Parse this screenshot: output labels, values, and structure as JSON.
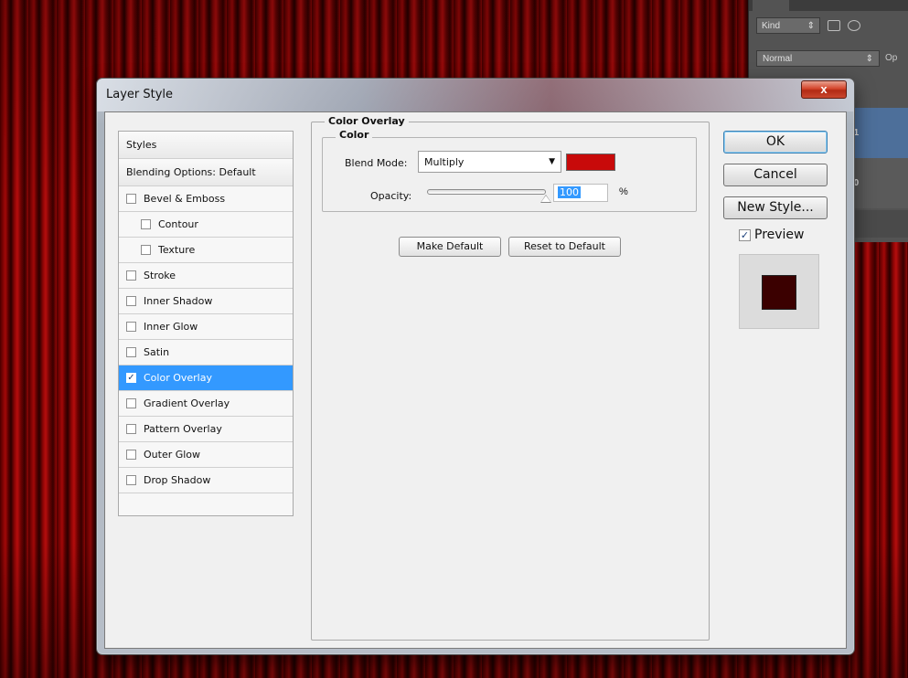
{
  "layers_panel": {
    "filter_label": "Kind",
    "blend_mode": "Normal",
    "opacity_label": "Op",
    "layers": [
      "r 1",
      "r 0"
    ]
  },
  "dialog": {
    "title": "Layer Style",
    "close_label": "x"
  },
  "styles_list": {
    "header": "Styles",
    "blending_options": "Blending Options: Default",
    "items": [
      {
        "label": "Bevel & Emboss",
        "checked": false,
        "indent": false,
        "selected": false
      },
      {
        "label": "Contour",
        "checked": false,
        "indent": true,
        "selected": false
      },
      {
        "label": "Texture",
        "checked": false,
        "indent": true,
        "selected": false
      },
      {
        "label": "Stroke",
        "checked": false,
        "indent": false,
        "selected": false
      },
      {
        "label": "Inner Shadow",
        "checked": false,
        "indent": false,
        "selected": false
      },
      {
        "label": "Inner Glow",
        "checked": false,
        "indent": false,
        "selected": false
      },
      {
        "label": "Satin",
        "checked": false,
        "indent": false,
        "selected": false
      },
      {
        "label": "Color Overlay",
        "checked": true,
        "indent": false,
        "selected": true
      },
      {
        "label": "Gradient Overlay",
        "checked": false,
        "indent": false,
        "selected": false
      },
      {
        "label": "Pattern Overlay",
        "checked": false,
        "indent": false,
        "selected": false
      },
      {
        "label": "Outer Glow",
        "checked": false,
        "indent": false,
        "selected": false
      },
      {
        "label": "Drop Shadow",
        "checked": false,
        "indent": false,
        "selected": false
      }
    ]
  },
  "color_overlay": {
    "section_title": "Color Overlay",
    "group_title": "Color",
    "blend_mode_label": "Blend Mode:",
    "blend_mode_value": "Multiply",
    "overlay_color": "#c80a0a",
    "opacity_label": "Opacity:",
    "opacity_value": "100",
    "opacity_unit": "%",
    "opacity_fraction": 1.0,
    "make_default": "Make Default",
    "reset_default": "Reset to Default"
  },
  "actions": {
    "ok": "OK",
    "cancel": "Cancel",
    "new_style": "New Style...",
    "preview_label": "Preview",
    "preview_checked": true,
    "preview_color": "#3b0000"
  }
}
